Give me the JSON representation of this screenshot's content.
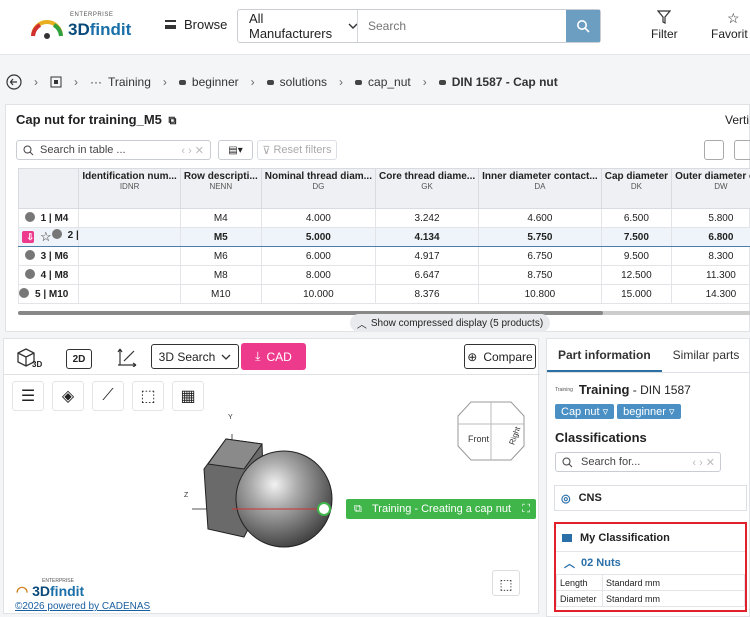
{
  "brand": {
    "enterprise": "ENTERPRISE",
    "name_a": "3D",
    "name_b": "findit"
  },
  "topbar": {
    "browse": "Browse",
    "manufacturer": "All Manufacturers",
    "search_placeholder": "Search",
    "filter": "Filter",
    "favorites": "Favorit"
  },
  "breadcrumb": [
    "Training",
    "beginner",
    "solutions",
    "cap_nut",
    "DIN 1587 - Cap nut"
  ],
  "table_panel": {
    "title": "Cap nut for training_M5",
    "vert": "Verti",
    "search_placeholder": "Search in table ...",
    "reset": "Reset filters",
    "columns": [
      {
        "label": "Identification num...",
        "code": "IDNR"
      },
      {
        "label": "Row descripti...",
        "code": "NENN"
      },
      {
        "label": "Nominal thread diam...",
        "code": "DG"
      },
      {
        "label": "Core thread diame...",
        "code": "GK"
      },
      {
        "label": "Inner diameter contact...",
        "code": "DA"
      },
      {
        "label": "Cap diameter",
        "code": "DK"
      },
      {
        "label": "Outer diameter con",
        "code": "DW"
      }
    ],
    "rows": [
      {
        "head": "1 | M4",
        "cells": [
          "",
          "M4",
          "4.000",
          "3.242",
          "4.600",
          "6.500",
          "5.800"
        ]
      },
      {
        "head": "2 | M5",
        "cells": [
          "",
          "M5",
          "5.000",
          "4.134",
          "5.750",
          "7.500",
          "6.800"
        ]
      },
      {
        "head": "3 | M6",
        "cells": [
          "",
          "M6",
          "6.000",
          "4.917",
          "6.750",
          "9.500",
          "8.300"
        ]
      },
      {
        "head": "4 | M8",
        "cells": [
          "",
          "M8",
          "8.000",
          "6.647",
          "8.750",
          "12.500",
          "11.300"
        ]
      },
      {
        "head": "5 | M10",
        "cells": [
          "",
          "M10",
          "10.000",
          "8.376",
          "10.800",
          "15.000",
          "14.300"
        ]
      }
    ],
    "compress": "Show compressed display (5 products)"
  },
  "viewer": {
    "btn_3d": "3D",
    "btn_2d": "2D",
    "search3d": "3D Search",
    "cad": "CAD",
    "compare": "Compare",
    "axis_y": "Y",
    "axis_z": "Z",
    "tag": "Training - Creating a cap nut",
    "cube_front": "Front",
    "cube_right": "Right",
    "powered": "©2026 powered by CADENAS"
  },
  "info": {
    "tab_part": "Part information",
    "tab_similar": "Similar parts",
    "logo_text": "Training",
    "title_bold": "Training",
    "title_rest": " - DIN 1587",
    "chips": [
      "Cap nut",
      "beginner"
    ],
    "classifications": "Classifications",
    "search_placeholder": "Search for...",
    "cns": "CNS",
    "my_classification": "My Classification",
    "group": "02 Nuts",
    "props": [
      {
        "k": "Length",
        "v": "Standard mm"
      },
      {
        "k": "Diameter",
        "v": "Standard mm"
      }
    ]
  },
  "colors": {
    "accent": "#6b9ec0",
    "cad": "#ee3a8c",
    "tag": "#3fb54a",
    "highlight": "#e0202a"
  }
}
